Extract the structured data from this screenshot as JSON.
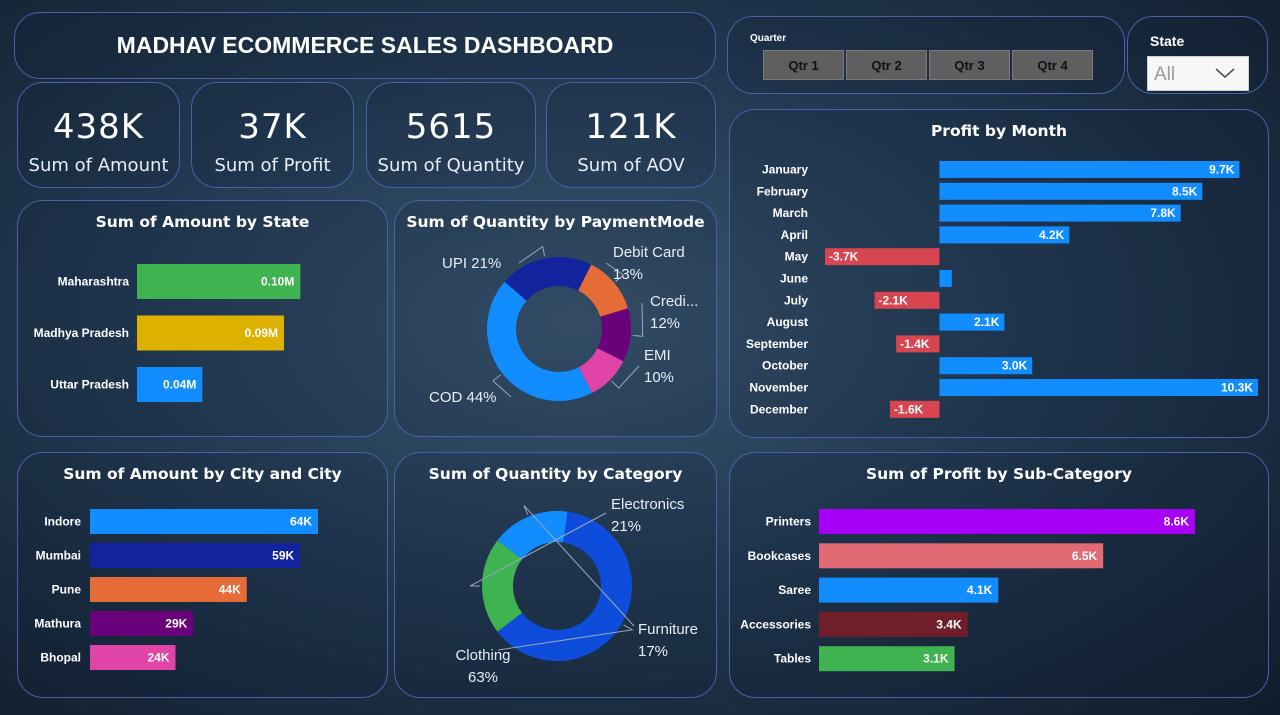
{
  "header": {
    "title": "MADHAV ECOMMERCE SALES DASHBOARD"
  },
  "kpis": [
    {
      "value": "438K",
      "label": "Sum of Amount"
    },
    {
      "value": "37K",
      "label": "Sum of Profit"
    },
    {
      "value": "5615",
      "label": "Sum of Quantity"
    },
    {
      "value": "121K",
      "label": "Sum of AOV"
    }
  ],
  "slicers": {
    "quarter": {
      "label": "Quarter",
      "options": [
        "Qtr 1",
        "Qtr 2",
        "Qtr 3",
        "Qtr 4"
      ]
    },
    "state": {
      "label": "State",
      "value": "All"
    }
  },
  "chart_data": [
    {
      "id": "amount_by_state",
      "type": "bar",
      "orientation": "horizontal",
      "title": "Sum of Amount by State",
      "categories": [
        "Maharashtra",
        "Madhya Pradesh",
        "Uttar Pradesh"
      ],
      "values": [
        0.1,
        0.09,
        0.04
      ],
      "value_labels": [
        "0.10M",
        "0.09M",
        "0.04M"
      ],
      "unit": "M",
      "colors": [
        "#3fb34f",
        "#dcb100",
        "#118dff"
      ],
      "xlim": [
        0,
        0.15
      ]
    },
    {
      "id": "quantity_by_paymentmode",
      "type": "pie",
      "donut": true,
      "title": "Sum of Quantity by PaymentMode",
      "categories": [
        "COD",
        "UPI",
        "Debit Card",
        "Credi...",
        "EMI"
      ],
      "values": [
        44,
        21,
        13,
        12,
        10
      ],
      "unit": "%",
      "colors": [
        "#118dff",
        "#12239e",
        "#e66c37",
        "#6b007b",
        "#e044a7"
      ]
    },
    {
      "id": "profit_by_month",
      "type": "bar",
      "orientation": "horizontal",
      "title": "Profit by Month",
      "categories": [
        "January",
        "February",
        "March",
        "April",
        "May",
        "June",
        "July",
        "August",
        "September",
        "October",
        "November",
        "December"
      ],
      "values": [
        9.7,
        8.5,
        7.8,
        4.2,
        -3.7,
        0.4,
        -2.1,
        2.1,
        -1.4,
        3.0,
        10.3,
        -1.6
      ],
      "value_labels": [
        "9.7K",
        "8.5K",
        "7.8K",
        "4.2K",
        "-3.7K",
        "",
        "-2.1K",
        "2.1K",
        "-1.4K",
        "3.0K",
        "10.3K",
        "-1.6K"
      ],
      "unit": "K",
      "positive_color": "#118dff",
      "negative_color": "#d64550",
      "xlim": [
        -3.7,
        10.3
      ]
    },
    {
      "id": "amount_by_city",
      "type": "bar",
      "orientation": "horizontal",
      "title": "Sum of Amount by City and City",
      "categories": [
        "Indore",
        "Mumbai",
        "Pune",
        "Mathura",
        "Bhopal"
      ],
      "values": [
        64,
        59,
        44,
        29,
        24
      ],
      "value_labels": [
        "64K",
        "59K",
        "44K",
        "29K",
        "24K"
      ],
      "unit": "K",
      "colors": [
        "#118dff",
        "#12239e",
        "#e66c37",
        "#6b007b",
        "#e044a7"
      ],
      "xlim": [
        0,
        64
      ]
    },
    {
      "id": "quantity_by_category",
      "type": "pie",
      "donut": true,
      "title": "Sum of Quantity by Category",
      "categories": [
        "Clothing",
        "Electronics",
        "Furniture"
      ],
      "values": [
        63,
        21,
        17
      ],
      "unit": "%",
      "colors": [
        "#0e4ddc",
        "#3fb34f",
        "#118dff"
      ]
    },
    {
      "id": "profit_by_subcategory",
      "type": "bar",
      "orientation": "horizontal",
      "title": "Sum of Profit by Sub-Category",
      "categories": [
        "Printers",
        "Bookcases",
        "Saree",
        "Accessories",
        "Tables"
      ],
      "values": [
        8.6,
        6.5,
        4.1,
        3.4,
        3.1
      ],
      "value_labels": [
        "8.6K",
        "6.5K",
        "4.1K",
        "3.4K",
        "3.1K"
      ],
      "unit": "K",
      "colors": [
        "#a800f7",
        "#e06b74",
        "#118dff",
        "#6f1e2a",
        "#3fb34f"
      ],
      "xlim": [
        0,
        8.6
      ]
    }
  ]
}
